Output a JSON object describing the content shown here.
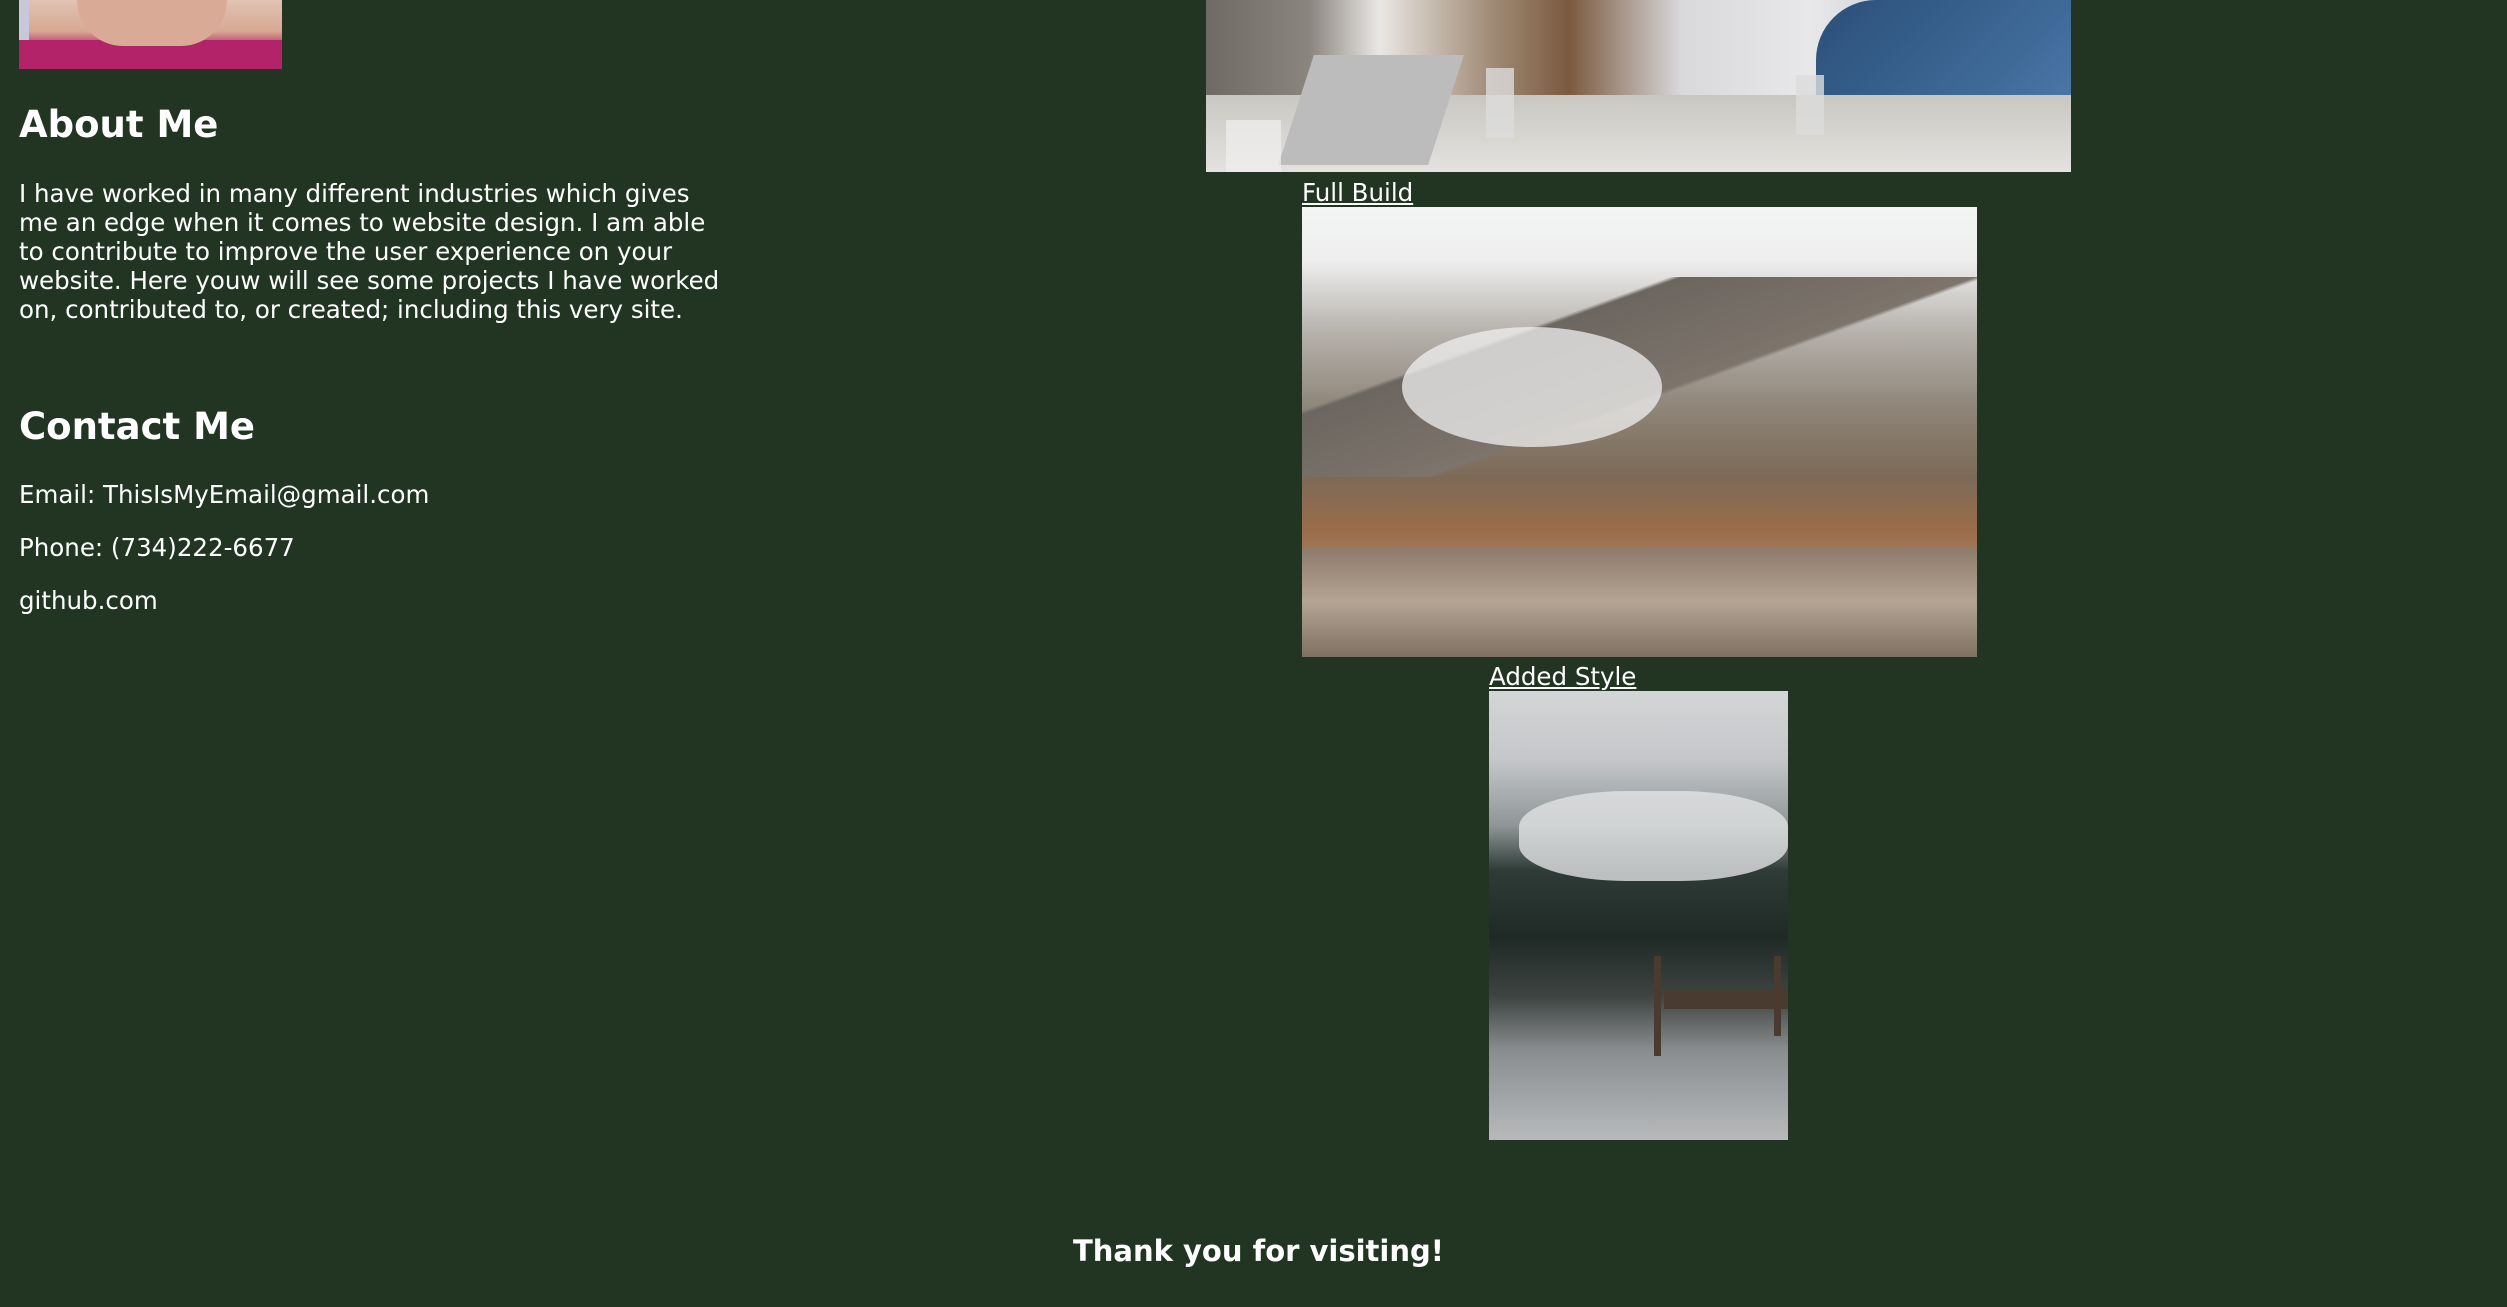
{
  "about": {
    "title": "About Me",
    "text": "I have worked in many different industries which gives me an edge when it comes to website design. I am able to contribute to improve the user experience on your website. Here youw will see some projects I have worked on, contributed to, or created; including this very site."
  },
  "contact": {
    "title": "Contact Me",
    "email": "Email: ThisIsMyEmail@gmail.com",
    "phone": "Phone: (734)222-6677",
    "github": "github.com"
  },
  "projects": [
    {
      "label": "Full Build"
    },
    {
      "label": "Added Style"
    }
  ],
  "footer": {
    "text": "Thank you for visiting!"
  }
}
